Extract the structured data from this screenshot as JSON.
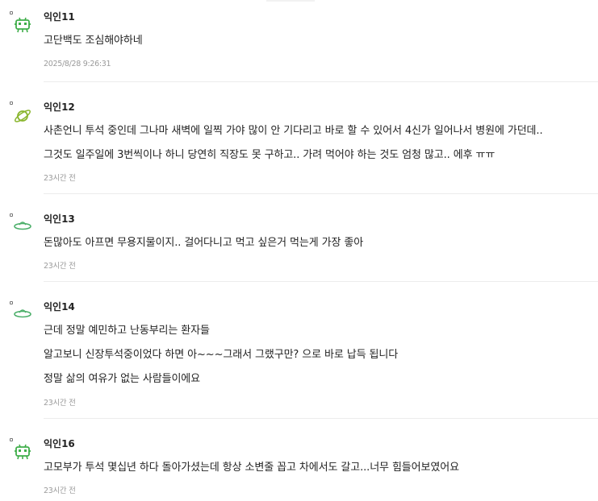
{
  "comments": [
    {
      "nickname": "익인11",
      "avatar_icon": "green-alien-bot-icon",
      "lines": [
        "고단백도 조심해야하네"
      ],
      "time": "2025/8/28 9:26:31"
    },
    {
      "nickname": "익인12",
      "avatar_icon": "green-planet-icon",
      "lines": [
        "사촌언니 투석 중인데 그나마 새벽에 일찍 가야 많이 안 기다리고 바로 할 수 있어서 4신가 일어나서 병원에 가던데..",
        "그것도 일주일에 3번씩이나 하니 당연히 직장도 못 구하고.. 가려 먹어야 하는 것도 엄청 많고.. 에후 ㅠㅠ"
      ],
      "time": "23시간 전"
    },
    {
      "nickname": "익인13",
      "avatar_icon": "green-ufo-icon",
      "lines": [
        "돈많아도 아프면 무용지물이지.. 걸어다니고 먹고 싶은거 먹는게 가장 좋아"
      ],
      "time": "23시간 전"
    },
    {
      "nickname": "익인14",
      "avatar_icon": "green-ufo-icon",
      "lines": [
        "근데 정말 예민하고 난동부리는 환자들",
        "알고보니 신장투석중이었다 하면 아~~~그래서 그랬구만? 으로 바로 납득 됩니다",
        "정말 삶의 여유가 없는 사람들이에요"
      ],
      "time": "23시간 전"
    },
    {
      "nickname": "익인16",
      "avatar_icon": "green-alien-bot-icon",
      "lines": [
        "고모부가 투석 몇십년 하다 돌아가셨는데 항상 소변줄 꼽고 차에서도 갈고...너무 힘들어보였어요"
      ],
      "time": "23시간 전"
    }
  ],
  "colors": {
    "icon_green": "#3fae4a",
    "planet_yellowgreen": "#8ab62f",
    "ufo_green": "#4caf6a",
    "time_gray": "#9a9a9a",
    "divider": "#ececec"
  }
}
